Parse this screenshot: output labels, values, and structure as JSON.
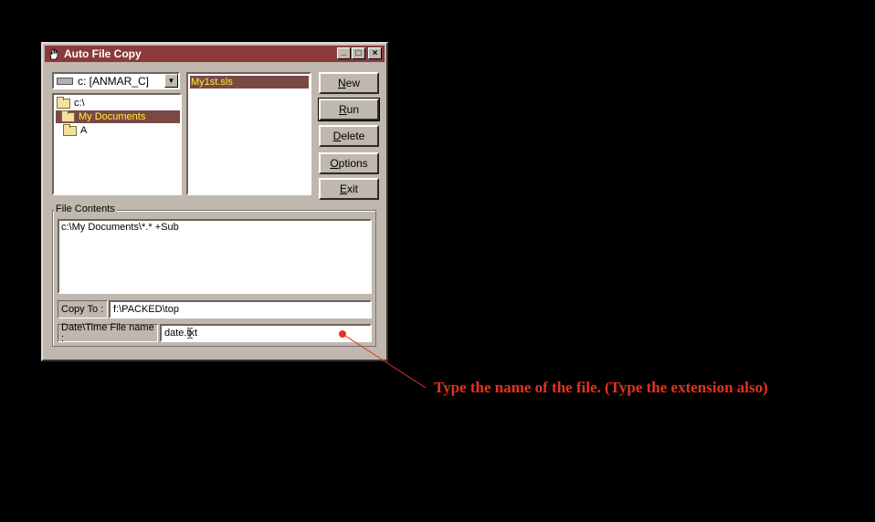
{
  "window": {
    "title": "Auto File Copy",
    "controls": {
      "minimize": "_",
      "maximize": "□",
      "close": "×"
    }
  },
  "drive_selector": {
    "value": "c: [ANMAR_C]"
  },
  "directory_tree": {
    "items": [
      {
        "label": "c:\\",
        "selected": false
      },
      {
        "label": "My Documents",
        "selected": true
      },
      {
        "label": "A",
        "selected": false
      }
    ]
  },
  "file_list": {
    "items": [
      "My1st.sls"
    ]
  },
  "buttons": {
    "new": "New",
    "run": "Run",
    "delete": "Delete",
    "options": "Options",
    "exit": "Exit"
  },
  "file_contents": {
    "label": "File Contents",
    "text": "c:\\My Documents\\*.* +Sub"
  },
  "copy_to": {
    "label": "Copy To :",
    "value": "f:\\PACKED\\top"
  },
  "datetime_file": {
    "label": "Date\\Time File name :",
    "value": "date.txt"
  },
  "annotation": {
    "text": "Type the name of the file. (Type the extension also)",
    "color": "#e8321e"
  }
}
